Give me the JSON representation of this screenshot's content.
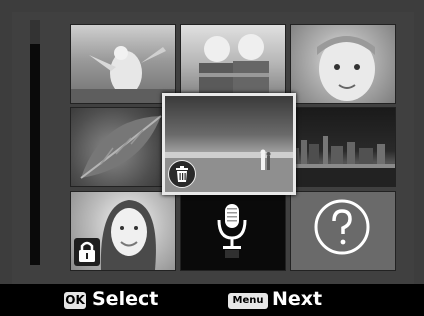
{
  "thumbnails": [
    {
      "name": "thumb-woman-with-child",
      "icon": "photo"
    },
    {
      "name": "thumb-twin-boys",
      "icon": "photo"
    },
    {
      "name": "thumb-smiling-child",
      "icon": "photo"
    },
    {
      "name": "thumb-leaves",
      "icon": "photo"
    },
    {
      "name": "thumb-beach-couple",
      "icon": "photo",
      "selected": true
    },
    {
      "name": "thumb-city-night",
      "icon": "photo"
    },
    {
      "name": "thumb-woman-portrait",
      "icon": "photo",
      "badge": "lock-icon"
    },
    {
      "name": "thumb-voice-memo",
      "icon": "microphone-icon"
    },
    {
      "name": "thumb-unknown-file",
      "icon": "question-icon"
    }
  ],
  "selected_badge": "trash-icon",
  "footer": {
    "ok_badge": "OK",
    "select_label": "Select",
    "menu_badge": "Menu",
    "next_label": "Next"
  }
}
